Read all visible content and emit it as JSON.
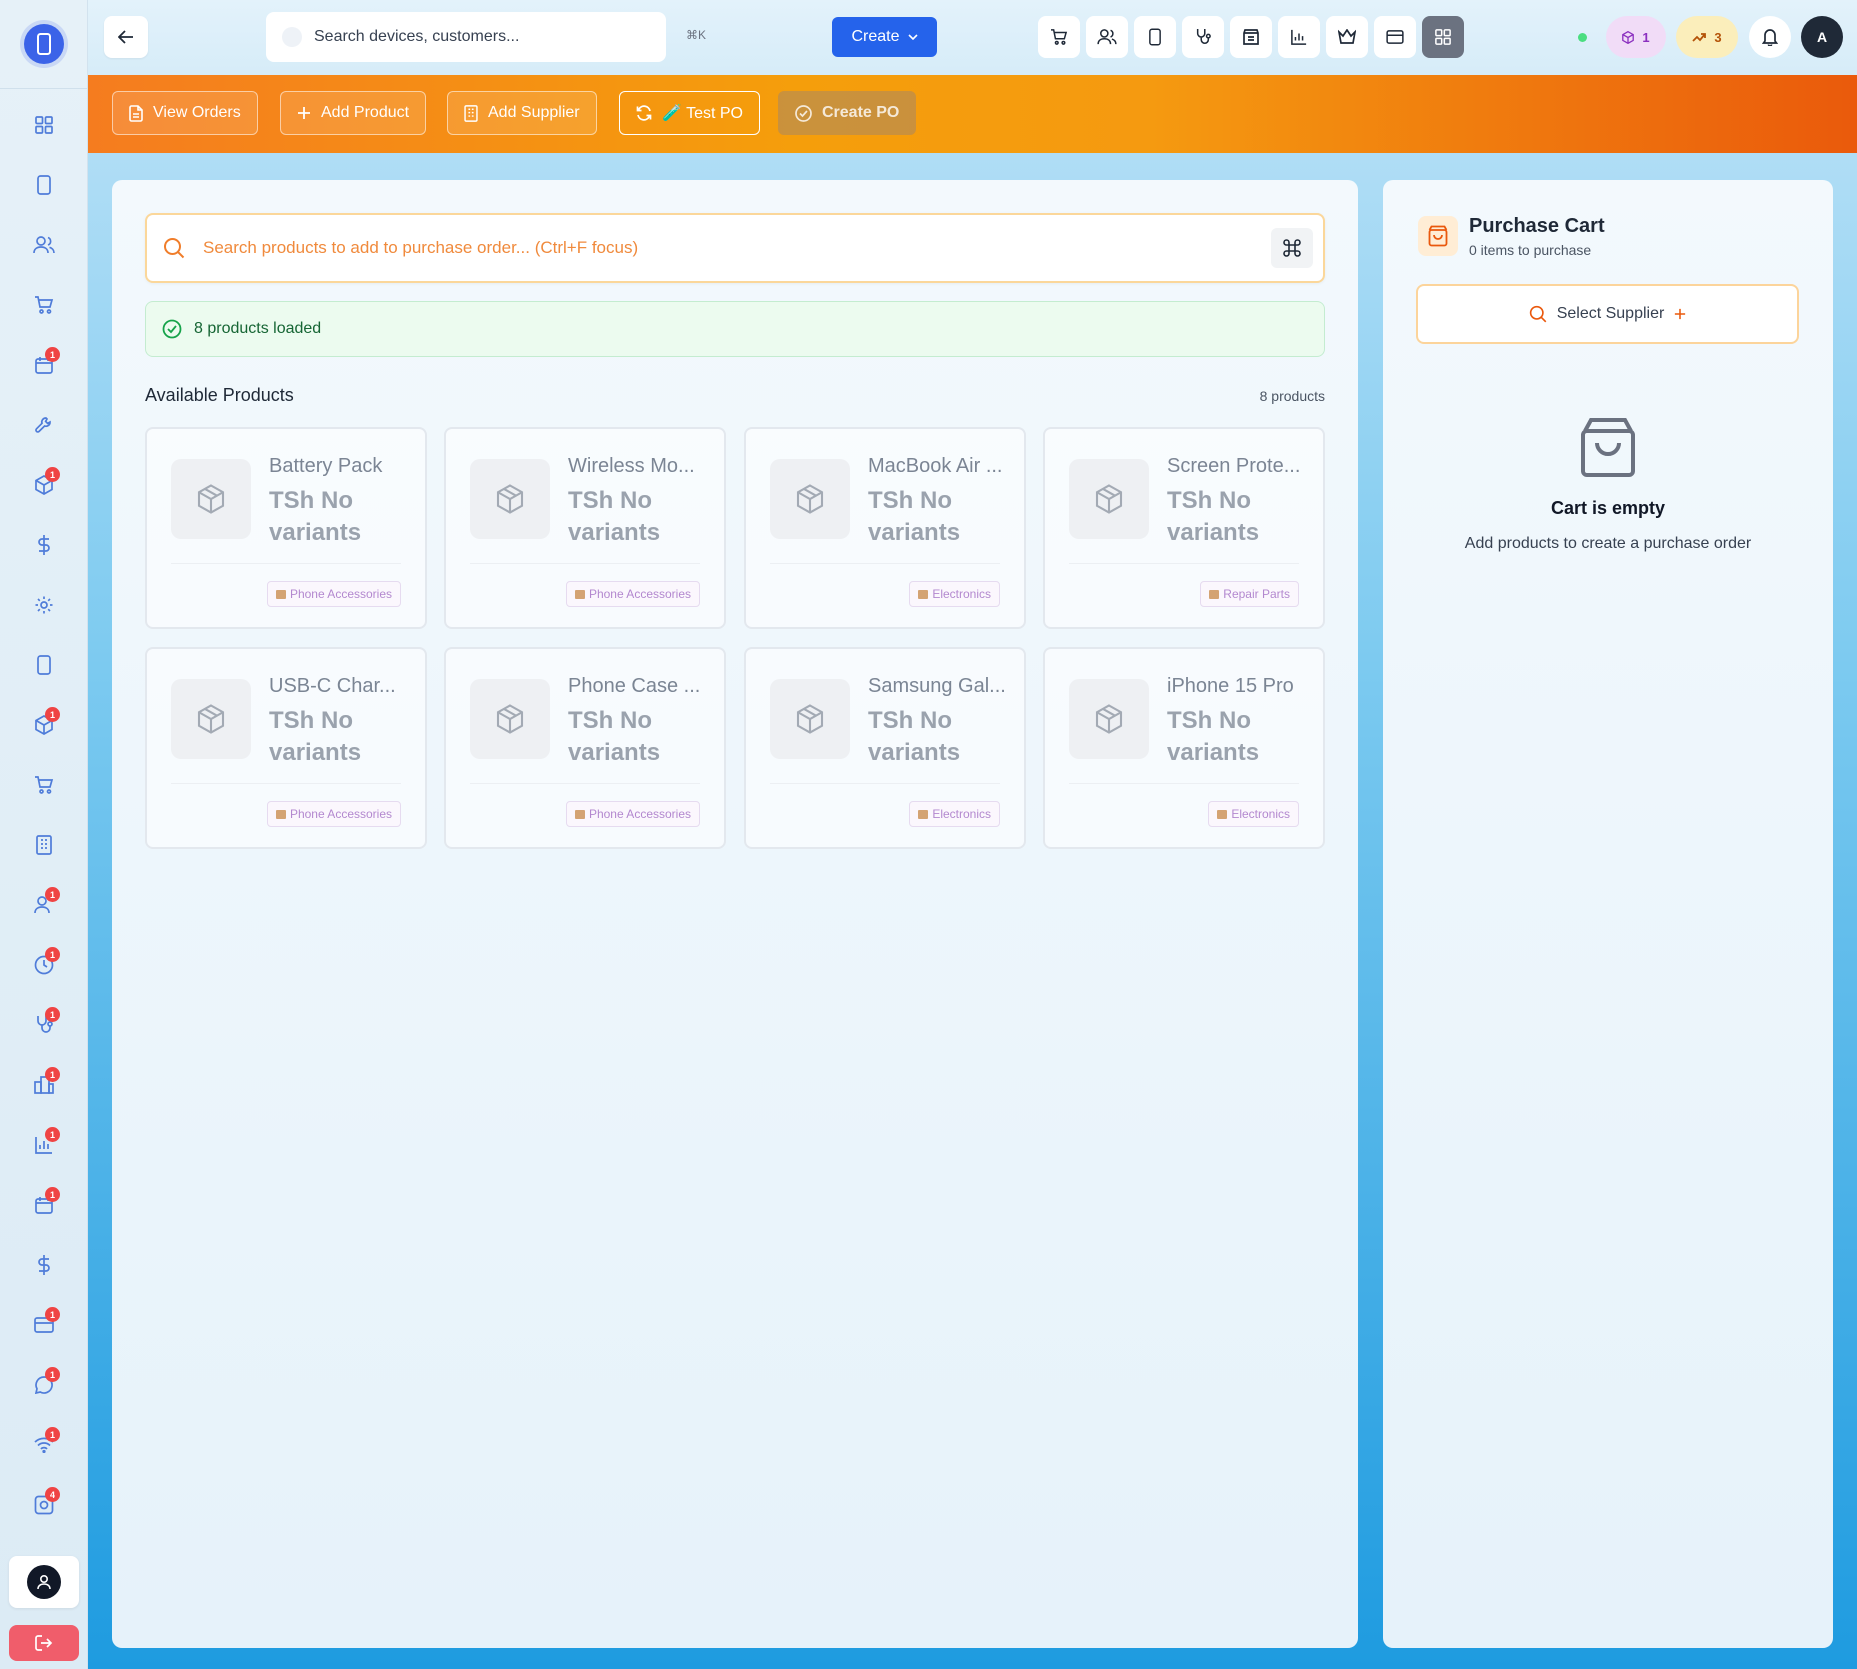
{
  "topbar": {
    "search_placeholder": "Search devices, customers...",
    "shortcut": "⌘K",
    "create_label": "Create",
    "notifications_count": "1",
    "trend_count": "3",
    "avatar_initial": "A"
  },
  "actions": {
    "view_orders": "View Orders",
    "add_product": "Add Product",
    "add_supplier": "Add Supplier",
    "test_po": "🧪 Test PO",
    "create_po": "Create PO"
  },
  "main": {
    "search_placeholder": "Search products to add to purchase order... (Ctrl+F focus)",
    "loaded_text": "8 products loaded",
    "section_title": "Available Products",
    "product_count": "8 products",
    "products": [
      {
        "name": "Battery Pack",
        "price": "TSh No variants",
        "category": "Phone Accessories"
      },
      {
        "name": "Wireless Mo...",
        "price": "TSh No variants",
        "category": "Phone Accessories"
      },
      {
        "name": "MacBook Air ...",
        "price": "TSh No variants",
        "category": "Electronics"
      },
      {
        "name": "Screen Prote...",
        "price": "TSh No variants",
        "category": "Repair Parts"
      },
      {
        "name": "USB-C Char...",
        "price": "TSh No variants",
        "category": "Phone Accessories"
      },
      {
        "name": "Phone Case ...",
        "price": "TSh No variants",
        "category": "Phone Accessories"
      },
      {
        "name": "Samsung Gal...",
        "price": "TSh No variants",
        "category": "Electronics"
      },
      {
        "name": "iPhone 15 Pro",
        "price": "TSh No variants",
        "category": "Electronics"
      }
    ]
  },
  "cart": {
    "title": "Purchase Cart",
    "subtitle": "0 items to purchase",
    "select_supplier": "Select Supplier",
    "empty_title": "Cart is empty",
    "empty_subtitle": "Add products to create a purchase order"
  },
  "sidebar": {
    "badges": {
      "appointments": "1",
      "inventory": "1",
      "spare_parts": "1",
      "employees": "1",
      "attendance": "1",
      "diagnostics": "1",
      "business": "1",
      "reports": "1",
      "calendar": "1",
      "payments": "1",
      "messages": "1",
      "network": "1",
      "settings": "4"
    }
  },
  "colors": {
    "primary": "#2563eb",
    "accent_orange": "#f59e0b",
    "badge_red": "#ef4444",
    "success": "#16a34a"
  }
}
